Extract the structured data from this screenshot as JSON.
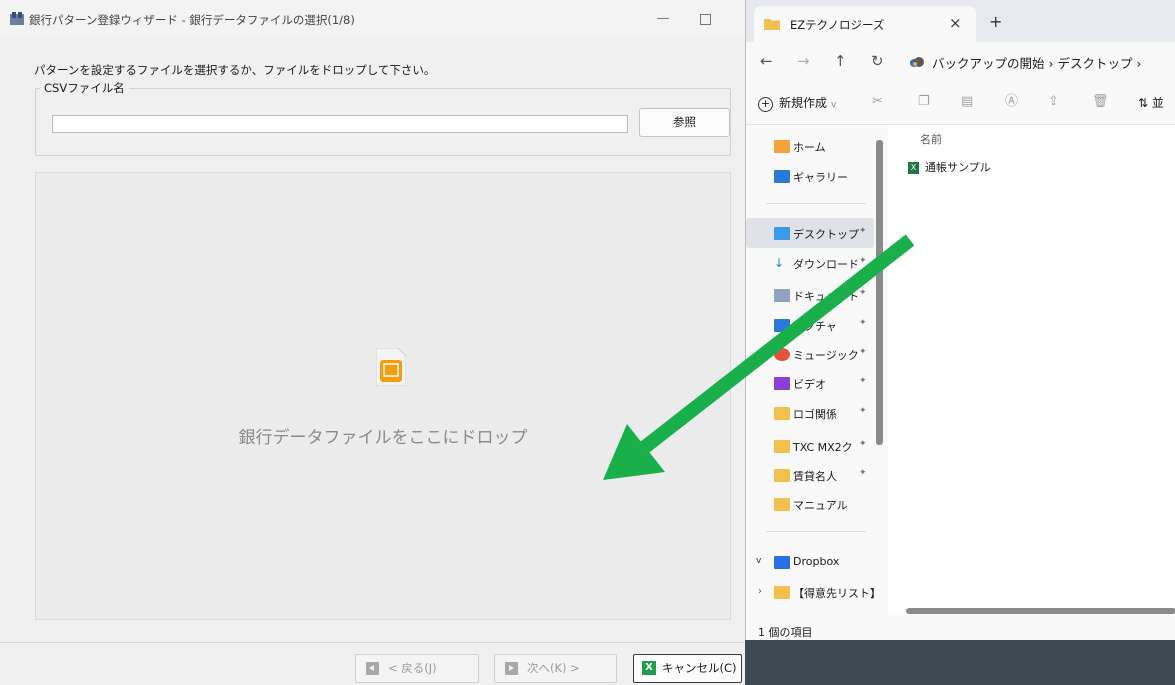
{
  "wizard": {
    "title": "銀行パターン登録ウィザード - 銀行データファイルの選択(1/8)",
    "instruction": "パターンを設定するファイルを選択するか、ファイルをドロップして下さい。",
    "csv_group_label": "CSVファイル名",
    "csv_value": "",
    "browse_label": "参照",
    "drop_text": "銀行データファイルをここにドロップ",
    "back_label": "< 戻る(J)",
    "next_label": "次へ(K) >",
    "cancel_label": "キャンセル(C)",
    "accent": "#1f9d4a"
  },
  "explorer": {
    "tab_title": "EZテクノロジーズ",
    "address": "バックアップの開始  ›  デスクトップ  ›",
    "new_label": "新規作成",
    "sort_label": "並",
    "nav_items": [
      {
        "label": "ホーム",
        "icon": "home-icon"
      },
      {
        "label": "ギャラリー",
        "icon": "gallery-icon"
      },
      {
        "label": "デスクトップ",
        "icon": "desktop-icon"
      },
      {
        "label": "ダウンロード",
        "icon": "download-icon"
      },
      {
        "label": "ドキュメント",
        "icon": "document-icon"
      },
      {
        "label": "ピクチャ",
        "icon": "picture-icon"
      },
      {
        "label": "ミュージック",
        "icon": "music-icon"
      },
      {
        "label": "ビデオ",
        "icon": "video-icon"
      },
      {
        "label": "ロゴ関係",
        "icon": "folder-icon"
      },
      {
        "label": "TXC  MX2ク",
        "icon": "folder-icon"
      },
      {
        "label": "賃貸名人",
        "icon": "folder-icon"
      },
      {
        "label": "マニュアル",
        "icon": "folder-icon"
      },
      {
        "label": "Dropbox",
        "icon": "dropbox-icon"
      },
      {
        "label": "【得意先リスト】",
        "icon": "folder-icon"
      }
    ],
    "column_name": "名前",
    "file_name": "通帳サンプル",
    "status": "1 個の項目"
  }
}
